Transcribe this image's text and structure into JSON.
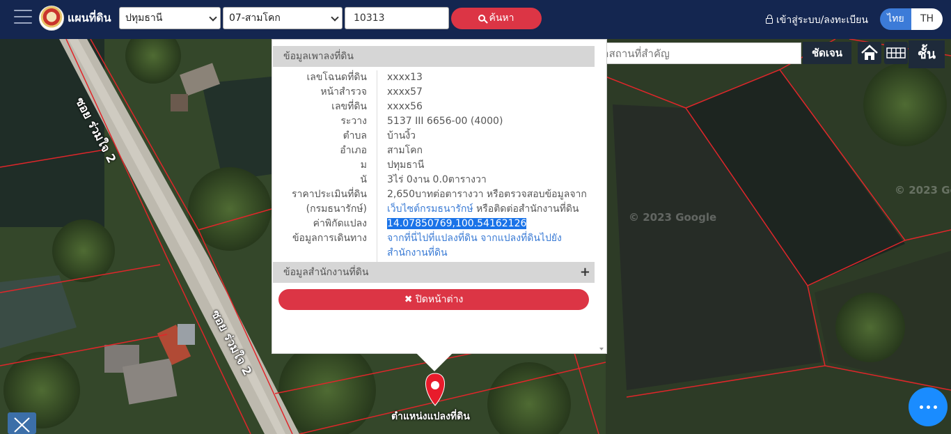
{
  "header": {
    "title": "แผนที่ดิน",
    "province": "ปทุมธานี",
    "district": "07-สามโคก",
    "deed_number": "10313",
    "search_label": "ค้นหา",
    "login_label": "เข้าสู่ระบบ/ลงทะเบียน",
    "lang_th": "ไทย",
    "lang_en": "TH"
  },
  "map_controls": {
    "place_search_placeholder": "ค้นหาสถานที่สำคัญ",
    "clear_label": "ชัดเจน",
    "layer_label": "ชั้น"
  },
  "map": {
    "road_label_1": "ซอย ร่วมใจ 2",
    "road_label_2": "ซอย ร่วมใจ 2",
    "watermark_1": "© 2023 Google",
    "watermark_2": "© 2023 Goo",
    "pin_label": "ตำแหน่งแปลงที่ดิน"
  },
  "popup": {
    "section_title": "ข้อมูลเพาลงที่ดิน",
    "rows": [
      {
        "label": "เลขโฉนดที่ดิน",
        "value": "xxxx13"
      },
      {
        "label": "หน้าสำรวจ",
        "value": "xxxx57"
      },
      {
        "label": "เลขที่ดิน",
        "value": "xxxx56"
      },
      {
        "label": "ระวาง",
        "value": "5137 III 6656-00 (4000)"
      },
      {
        "label": "ตำบล",
        "value": "บ้านงิ้ว"
      },
      {
        "label": "อำเภอ",
        "value": "สามโคก"
      },
      {
        "label": "ม",
        "value": "ปทุมธานี"
      },
      {
        "label": "นั",
        "value": "3ไร่ 0งาน 0.0ตารางวา"
      }
    ],
    "price_label_1": "ราคาประเมินที่ดิน",
    "price_label_2": "(กรมธนารักษ์)",
    "price_value": "2,650บาทต่อตารางวา หรือตรวจสอบข้อมูลจาก",
    "price_link": "เว็บไซต์กรมธนารักษ์",
    "price_suffix": " หรือติดต่อสำนักงานที่ดิน",
    "coord_label": "ค่าพิกัดแปลง",
    "coord_value": "14.07850769,100.54162126",
    "travel_label": "ข้อมูลการเดินทาง",
    "travel_link_1": "จากที่นี่ไปที่แปลงที่ดิน",
    "travel_link_2": "จากแปลงที่ดินไปยังสำนักงานที่ดิน",
    "office_section": "ข้อมูลสำนักงานที่ดิน",
    "office_plus": "+",
    "close_label": "ปิดหน้าต่าง"
  },
  "colors": {
    "topbar": "#142650",
    "accent_red": "#dc3545",
    "accent_blue": "#3c7bd8",
    "parcel_line": "#e0262a",
    "fab": "#1a8cff"
  }
}
